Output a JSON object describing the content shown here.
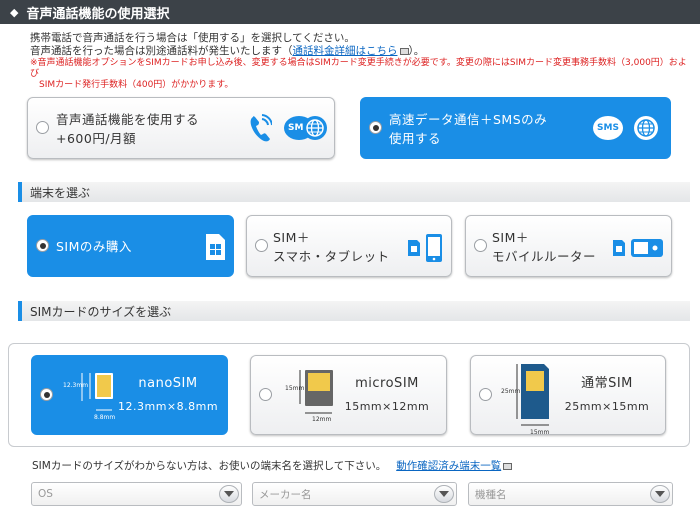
{
  "header": {
    "title": "音声通話機能の使用選択"
  },
  "notes": {
    "line1": "携帯電話で音声通話を行う場合は「使用する」を選択してください。",
    "line2_prefix": "音声通話を行った場合は別途通話料が発生いたします（",
    "line2_link": "通話料金詳細はこちら",
    "line2_suffix": "）。",
    "warn1": "※音声通話機能オプションをSIMカードお申し込み後、変更する場合はSIMカード変更手続きが必要です。変更の際にはSIMカード変更事務手数料（3,000円）および",
    "warn2": "SIMカード発行手数料（400円）がかかります。"
  },
  "voice_options": [
    {
      "line1": "音声通話機能を使用する",
      "line2": "+600円/月額",
      "selected": false
    },
    {
      "line1": "高速データ通信＋SMSのみ",
      "line2": "使用する",
      "selected": true
    }
  ],
  "sms_label": "SMS",
  "section_device": {
    "title": "端末を選ぶ"
  },
  "device_options": [
    {
      "line1": "SIMのみ購入",
      "line2": "",
      "selected": true
    },
    {
      "line1": "SIM＋",
      "line2": "スマホ・タブレット",
      "selected": false
    },
    {
      "line1": "SIM＋",
      "line2": "モバイルルーター",
      "selected": false
    }
  ],
  "section_size": {
    "title": "SIMカードのサイズを選ぶ"
  },
  "size_options": [
    {
      "name": "nanoSIM",
      "dims": "12.3mm×8.8mm",
      "selected": true,
      "dim_h": "12.3mm",
      "dim_w": "8.8mm"
    },
    {
      "name": "microSIM",
      "dims": "15mm×12mm",
      "selected": false,
      "dim_h": "15mm",
      "dim_w": "12mm"
    },
    {
      "name": "通常SIM",
      "dims": "25mm×15mm",
      "selected": false,
      "dim_h": "25mm",
      "dim_w": "15mm"
    }
  ],
  "hint": {
    "text": "SIMカードのサイズがわからない方は、お使いの端末名を選択して下さい。",
    "link": "動作確認済み端末一覧"
  },
  "selects": [
    {
      "placeholder": "OS"
    },
    {
      "placeholder": "メーカー名"
    },
    {
      "placeholder": "機種名"
    }
  ],
  "colors": {
    "accent": "#1a8ee6",
    "header_bg": "#3c4248",
    "warn": "#dd2222",
    "link": "#0a66c2"
  }
}
